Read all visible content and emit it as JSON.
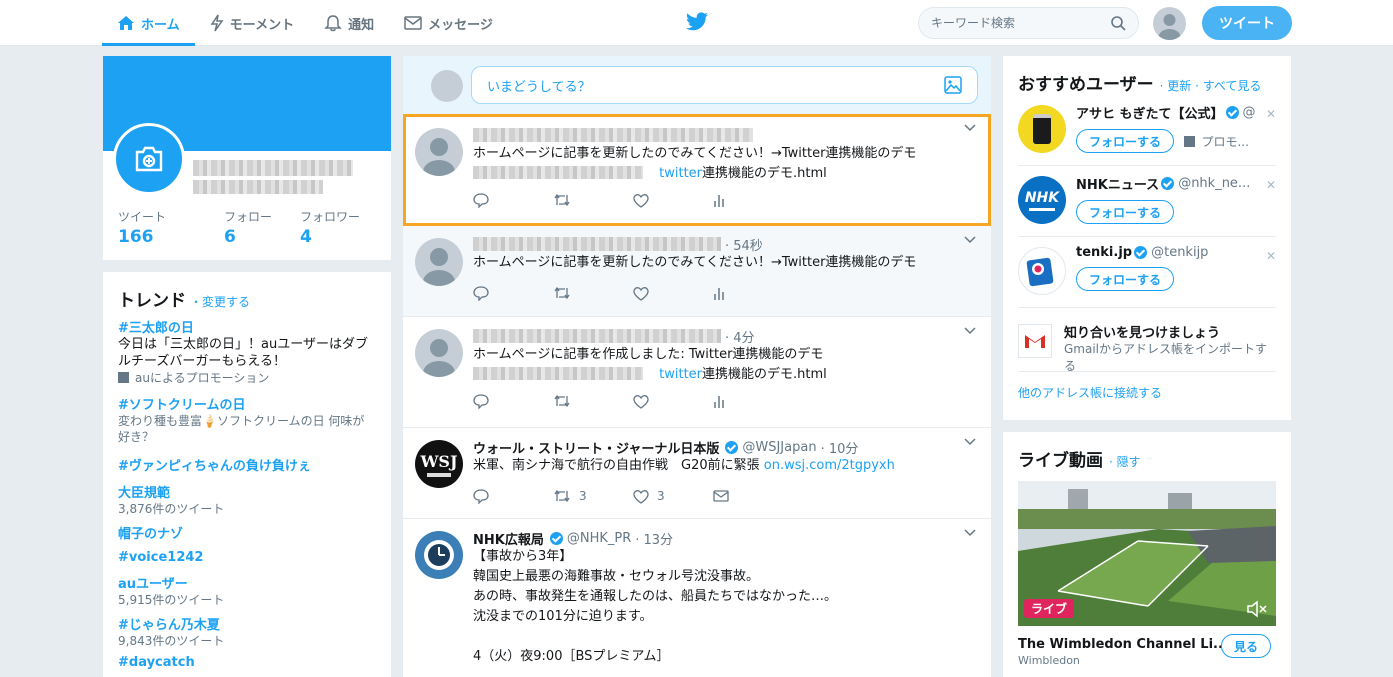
{
  "nav": {
    "home": "ホーム",
    "moments": "モーメント",
    "notifications": "通知",
    "messages": "メッセージ"
  },
  "search": {
    "placeholder": "キーワード検索"
  },
  "tweet_button": "ツイート",
  "profile": {
    "stats": [
      {
        "label": "ツイート",
        "value": "166"
      },
      {
        "label": "フォロー",
        "value": "6"
      },
      {
        "label": "フォロワー",
        "value": "4"
      }
    ]
  },
  "trends": {
    "title": "トレンド",
    "change": "・変更する",
    "items": [
      {
        "tag": "#三太郎の日",
        "desc": "今日は「三太郎の日」！auユーザーはダブルチーズバーガーもらえる！",
        "meta": "auによるプロモーション"
      },
      {
        "tag": "#ソフトクリームの日",
        "desc": "変わり種も豊富🍦ソフトクリームの日 何味が好き？"
      },
      {
        "tag": "#ヴァンピィちゃんの負け負けぇ"
      },
      {
        "tag": "大臣規範",
        "meta": "3,876件のツイート"
      },
      {
        "tag": "帽子のナゾ"
      },
      {
        "tag": "#voice1242"
      },
      {
        "tag": "auユーザー",
        "meta": "5,915件のツイート"
      },
      {
        "tag": "#じゃらん乃木夏",
        "meta": "9,843件のツイート"
      },
      {
        "tag": "#daycatch"
      }
    ]
  },
  "compose": {
    "placeholder": "いまどうしてる？"
  },
  "tweets": [
    {
      "text": "ホームページに記事を更新したのでみてください！→Twitter連携機能のデモ",
      "link": "twitter",
      "link_rest": "連携機能のデモ.html",
      "time": ""
    },
    {
      "text": "ホームページに記事を更新したのでみてください！→Twitter連携機能のデモ",
      "time": "· 54秒"
    },
    {
      "text": "ホームページに記事を作成しました: Twitter連携機能のデモ",
      "link": "twitter",
      "link_rest": "連携機能のデモ.html",
      "time": "· 4分"
    },
    {
      "name": "ウォール・ストリート・ジャーナル日本版",
      "handle": "@WSJJapan",
      "time": "· 10分",
      "text": "米軍、南シナ海で航行の自由作戦　G20前に緊張 ",
      "link": "on.wsj.com/2tgpyxh",
      "retweets": "3",
      "likes": "3"
    },
    {
      "name": "NHK広報局",
      "handle": "@NHK_PR",
      "time": "· 13分",
      "lines": [
        "【事故から3年】",
        "韓国史上最悪の海難事故・セウォル号沈没事故。",
        "あの時、事故発生を通報したのは、船員たちではなかった…。",
        "沈没までの101分に迫ります。",
        "",
        "4（火）夜9:00［BSプレミアム］"
      ]
    }
  ],
  "who_to_follow": {
    "title": "おすすめユーザー",
    "refresh": "· 更新 · すべて見る",
    "users": [
      {
        "name": "アサヒ もぎたて【公式】",
        "handle": "@",
        "button": "フォローする",
        "promo": "プロモ..."
      },
      {
        "name": "NHKニュース",
        "handle": "@nhk_ne...",
        "button": "フォローする"
      },
      {
        "name": "tenki.jp",
        "handle": "@tenkijp",
        "button": "フォローする"
      }
    ],
    "find_title": "知り合いを見つけましょう",
    "find_desc": "Gmailからアドレス帳をインポートする",
    "connect": "他のアドレス帳に接続する"
  },
  "live": {
    "title": "ライブ動画",
    "hide": "· 隠す",
    "badge": "ライブ",
    "video_title": "The Wimbledon Channel Li...",
    "channel": "Wimbledon",
    "watch": "見る"
  },
  "colors": {
    "accent": "#1da1f2",
    "focus": "#f7a623",
    "background": "#e6ecf0"
  }
}
